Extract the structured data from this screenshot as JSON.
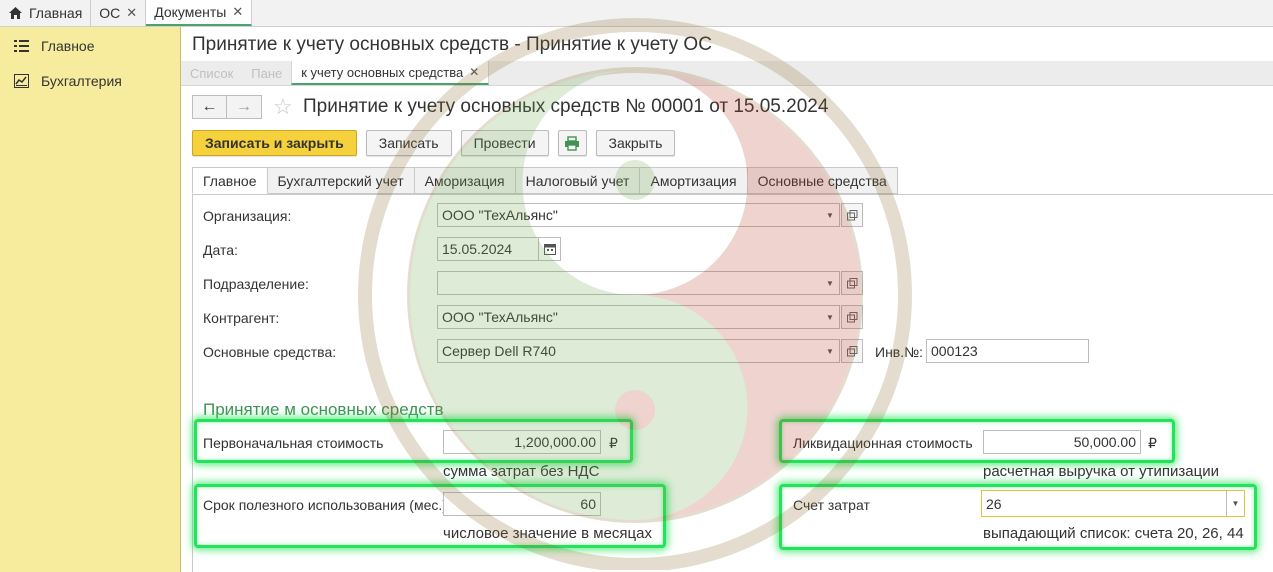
{
  "top_tabs": [
    {
      "label": "Главная",
      "icon": "home-icon",
      "closable": false
    },
    {
      "label": "ОС",
      "closable": true
    },
    {
      "label": "Документы",
      "closable": true
    }
  ],
  "sidebar": {
    "items": [
      {
        "label": "Главное",
        "icon": "list-icon"
      },
      {
        "label": "Бухгалтерия",
        "icon": "chart-icon"
      }
    ]
  },
  "window_title": "Принятие к учету основных средств  -  Принятие к учету ОС",
  "sub_tabs": [
    {
      "label": "Список"
    },
    {
      "label": "Пане"
    },
    {
      "label": "к учету основных средства"
    }
  ],
  "form_title": "Принятие к учету основных средств № 00001 от 15.05.2024",
  "toolbar": {
    "save_close": "Записать и закрыть",
    "save": "Записать",
    "post": "Провести",
    "close": "Закрыть"
  },
  "form_tabs": [
    "Главное",
    "Бухгалтерский учет",
    "Аморизация",
    "Налоговый учет",
    "Амортизация",
    "Основные средства"
  ],
  "fields": {
    "organization": {
      "label": "Организация:",
      "value": "ООО \"ТехАльянс\""
    },
    "date": {
      "label": "Дата:",
      "value": "15.05.2024"
    },
    "department": {
      "label": "Подразделение:",
      "value": ""
    },
    "counterparty": {
      "label": "Контрагент:",
      "value": "ООО \"ТехАльянс\""
    },
    "fixed_asset": {
      "label": "Основные средства:",
      "value": "Сервер Dell R740"
    },
    "inv_no": {
      "label": "Инв.№:",
      "value": "000123"
    }
  },
  "section_title": "Принятие м основных средств",
  "acceptance": {
    "initial_cost": {
      "label": "Первоначальная стоимость",
      "value": "1,200,000.00",
      "currency": "₽",
      "hint": "сумма затрат без НДС"
    },
    "salvage_value": {
      "label": "Ликвидационная стоимость",
      "value": "50,000.00",
      "currency": "₽",
      "hint": "расчетная выручка от утипизации"
    },
    "useful_life": {
      "label": "Срок полезного использования (мес.)",
      "value": "60",
      "hint": "числовое значение в месяцах"
    },
    "cost_account": {
      "label": "Счет затрат",
      "value": "26",
      "hint": "выпадающий список: счета 20, 26, 44"
    }
  },
  "colors": {
    "accent_green": "#3f9353",
    "primary_button": "#f5d13b",
    "sidebar_bg": "#f7ec9e",
    "highlight": "#22e35a"
  }
}
